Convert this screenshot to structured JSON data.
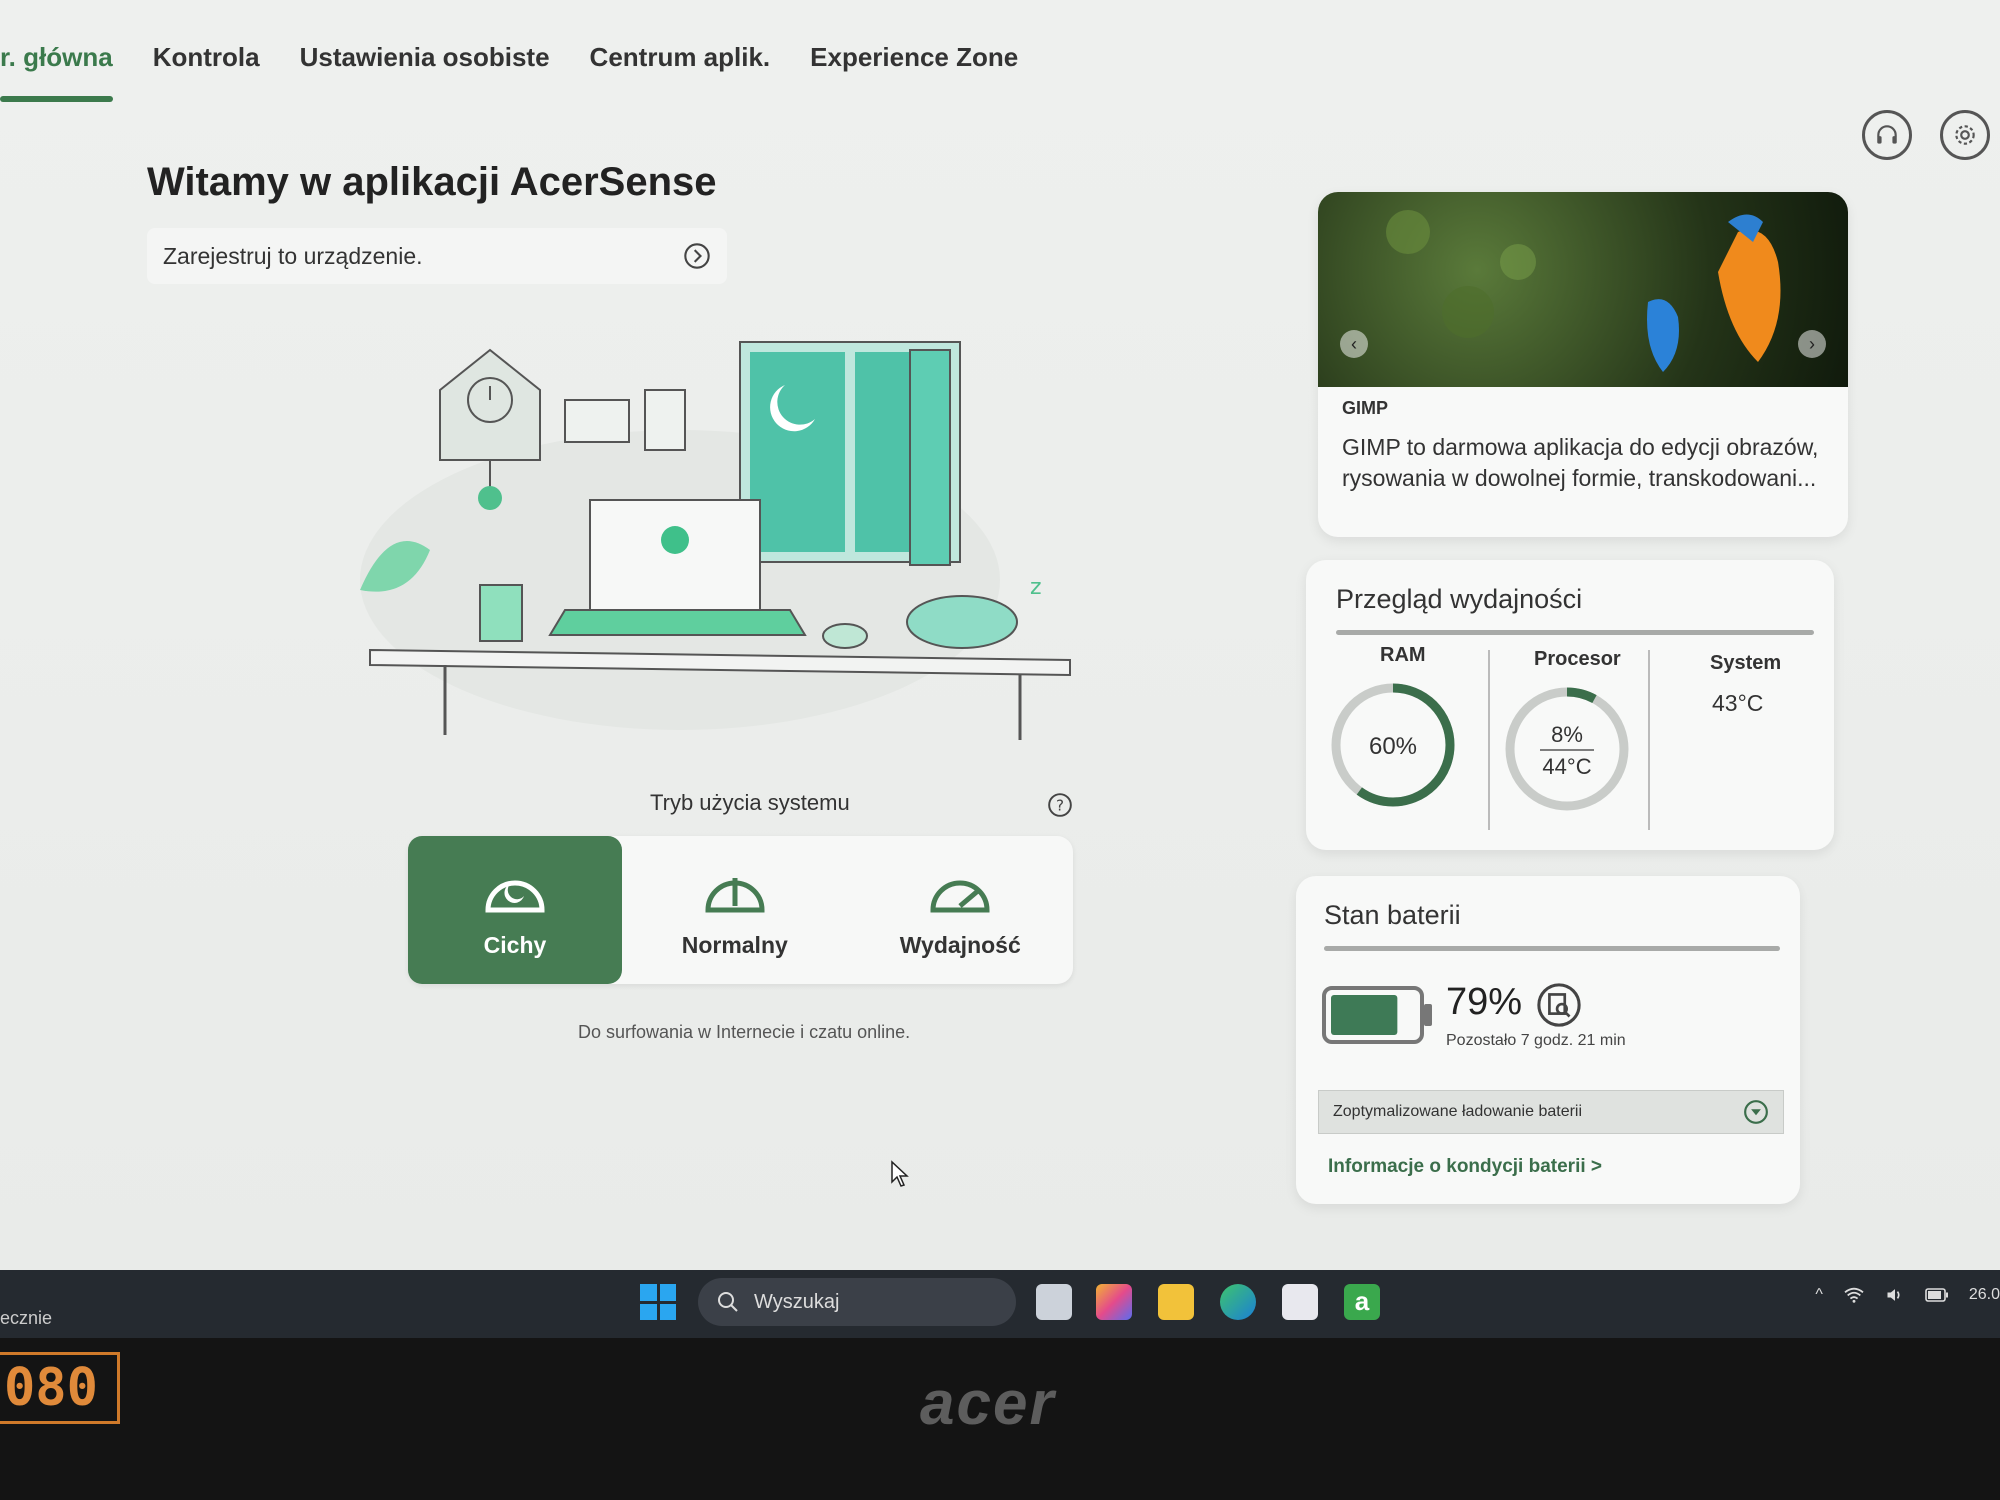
{
  "nav": {
    "items": [
      "r. główna",
      "Kontrola",
      "Ustawienia osobiste",
      "Centrum aplik.",
      "Experience Zone"
    ],
    "active_index": 0
  },
  "header": {
    "support_icon": "headset-icon",
    "settings_icon": "gear-icon"
  },
  "welcome": {
    "title": "Witamy w aplikacji AcerSense",
    "register_text": "Zarejestruj to urządzenie."
  },
  "system_mode": {
    "title": "Tryb użycia systemu",
    "modes": [
      {
        "label": "Cichy",
        "active": true
      },
      {
        "label": "Normalny",
        "active": false
      },
      {
        "label": "Wydajność",
        "active": false
      }
    ],
    "description": "Do surfowania w Internecie i czatu online."
  },
  "promo": {
    "app_name": "GIMP",
    "text": "GIMP to darmowa aplikacja do edycji obrazów, rysowania w dowolnej formie, transkodowani..."
  },
  "performance": {
    "title": "Przegląd wydajności",
    "ram_label": "RAM",
    "ram_value": "60%",
    "ram_fraction": 0.6,
    "cpu_label": "Procesor",
    "cpu_usage": "8%",
    "cpu_fraction": 0.08,
    "cpu_temp": "44°C",
    "system_label": "System",
    "system_temp": "43°C"
  },
  "battery": {
    "title": "Stan baterii",
    "percent": "79%",
    "level": 0.79,
    "remaining": "Pozostało 7 godz. 21 min",
    "charging_mode": "Zoptymalizowane ładowanie baterii",
    "health_link": "Informacje o kondycji baterii >"
  },
  "taskbar": {
    "left_text": "ecznie",
    "search_placeholder": "Wyszukaj",
    "clock_fragment": "26.0"
  },
  "hardware": {
    "brand": "acer",
    "badge": "080"
  },
  "colors": {
    "accent": "#467c53",
    "link": "#3b6e4b"
  }
}
